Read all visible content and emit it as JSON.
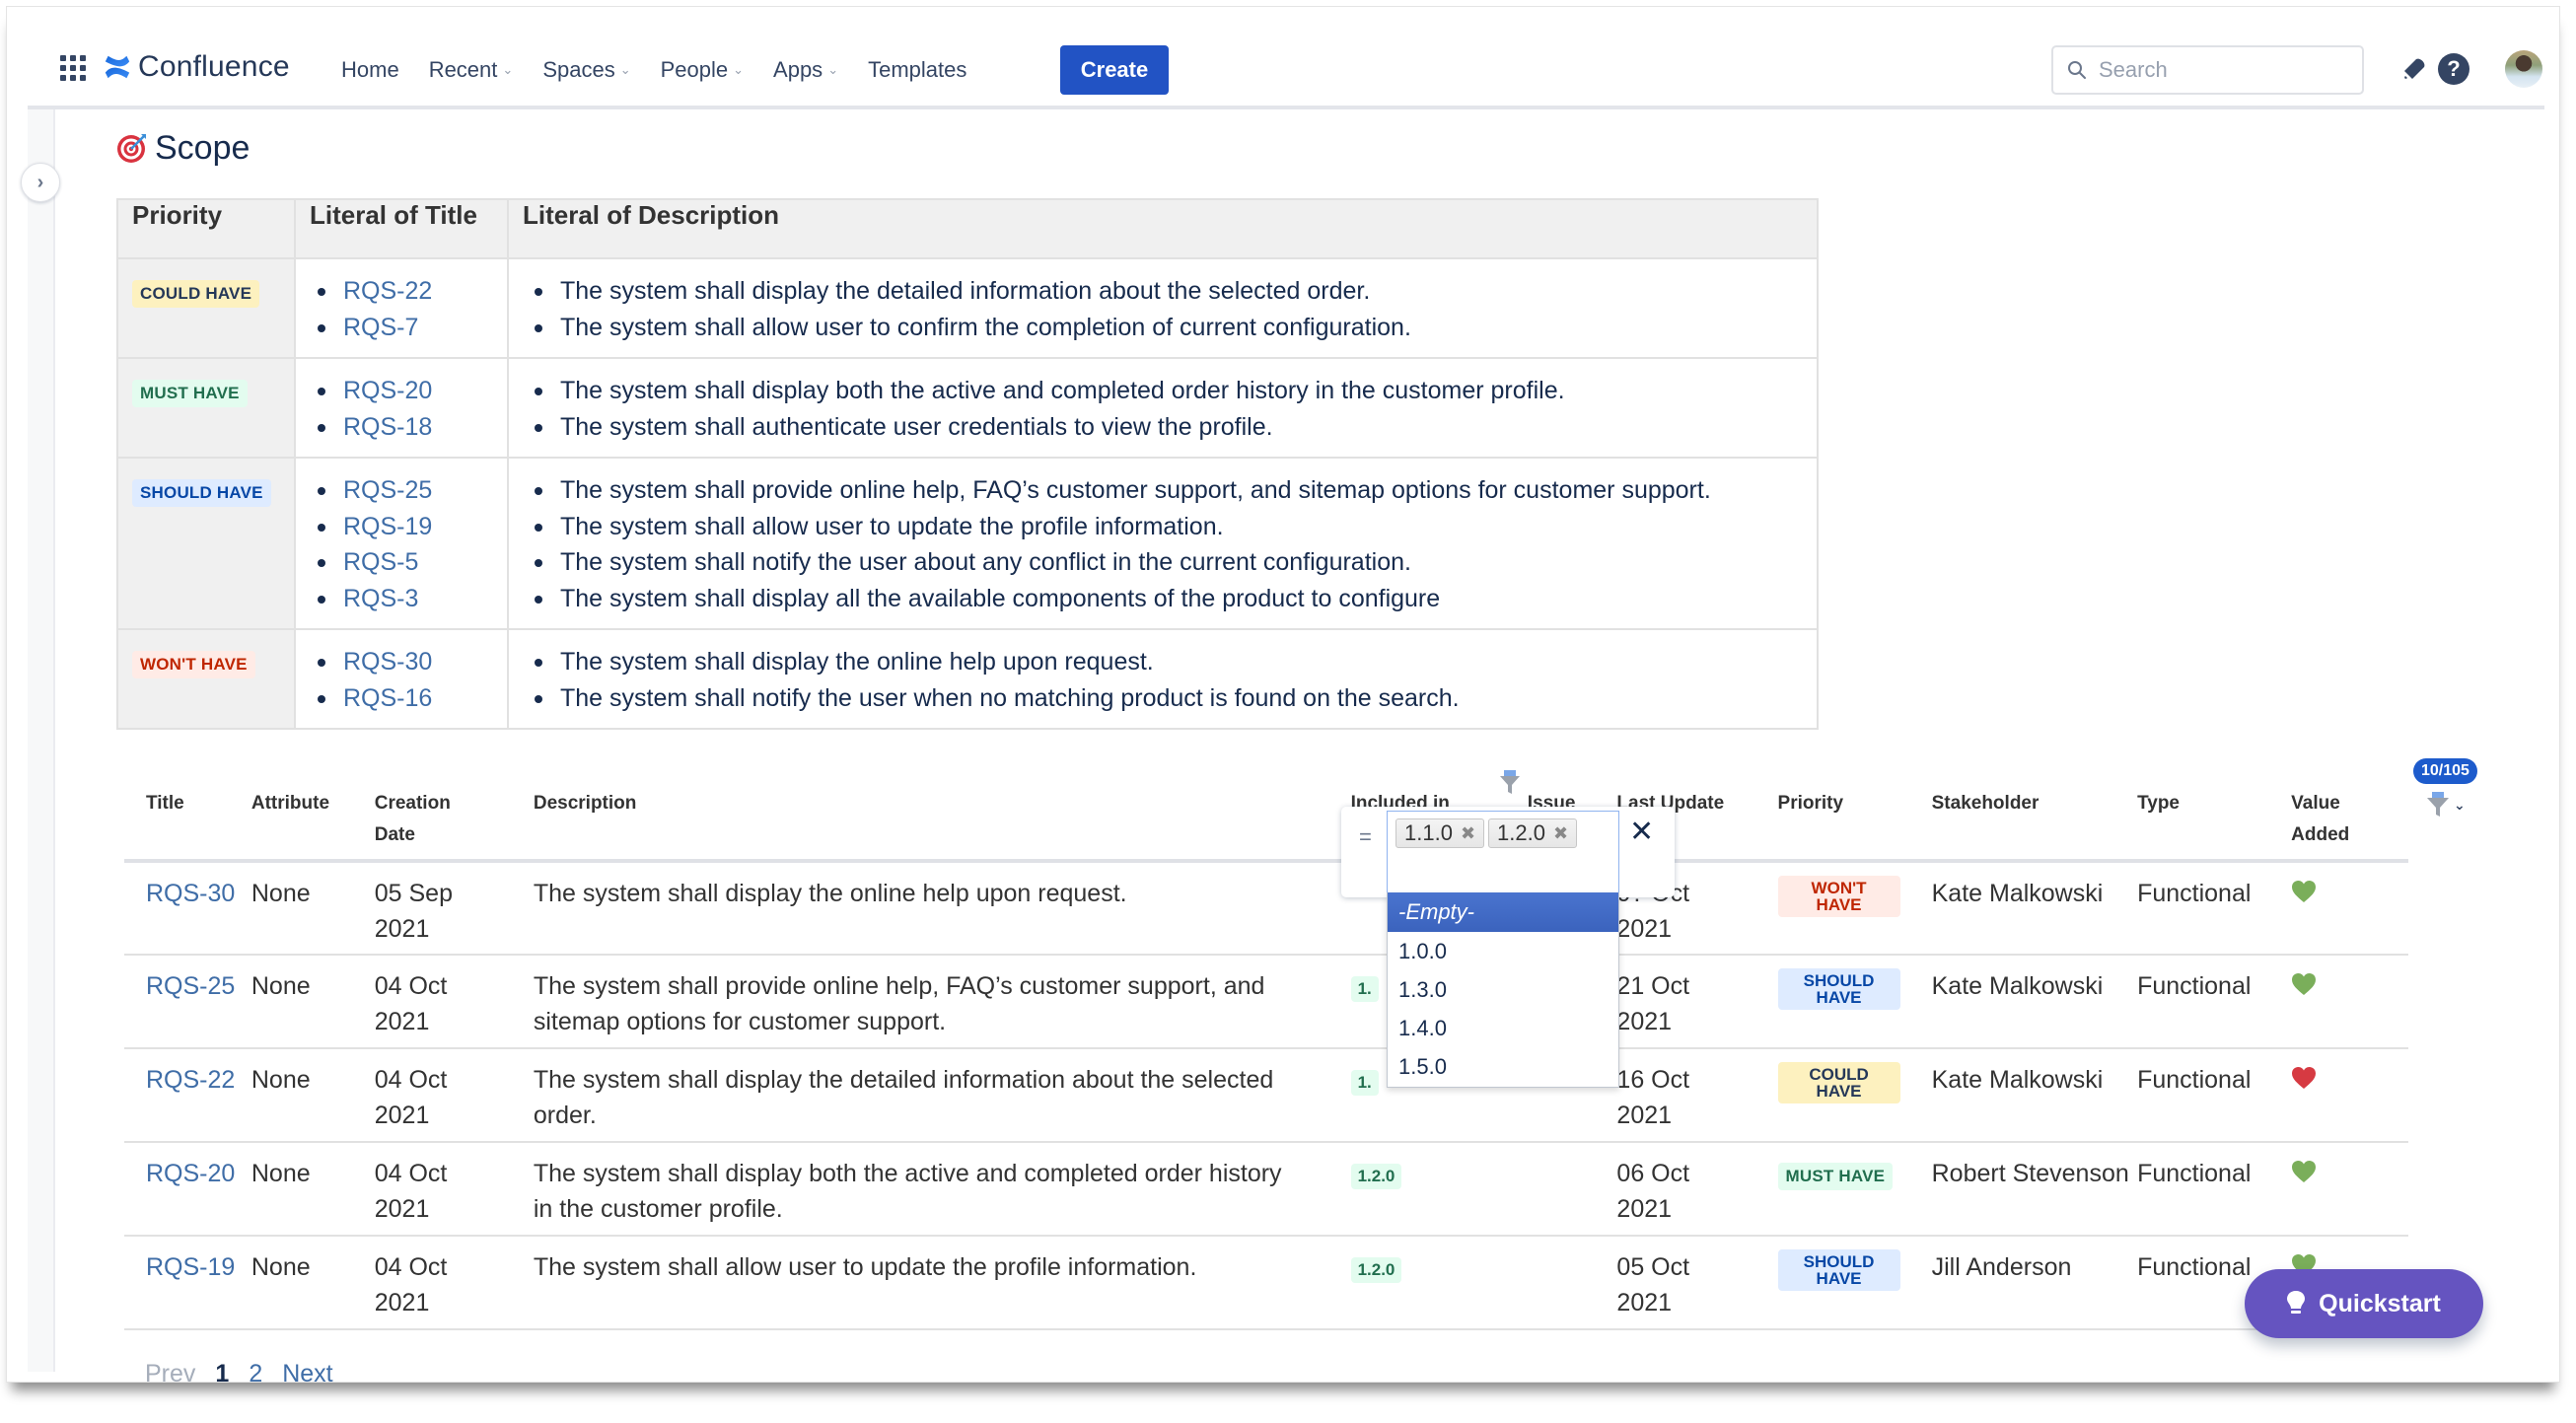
{
  "header": {
    "app_name": "Confluence",
    "nav": [
      {
        "label": "Home",
        "has_dropdown": false
      },
      {
        "label": "Recent",
        "has_dropdown": true
      },
      {
        "label": "Spaces",
        "has_dropdown": true
      },
      {
        "label": "People",
        "has_dropdown": true
      },
      {
        "label": "Apps",
        "has_dropdown": true
      },
      {
        "label": "Templates",
        "has_dropdown": false
      }
    ],
    "create_label": "Create",
    "search_placeholder": "Search",
    "icons": [
      "app-switcher-icon",
      "confluence-logo-icon",
      "notifications-icon",
      "help-icon",
      "avatar"
    ]
  },
  "sidebar": {
    "toggle_icon": "chevron-right-icon"
  },
  "page": {
    "section_title": "Scope",
    "section_icon": "target-icon"
  },
  "scope_table": {
    "headers": [
      "Priority",
      "Literal of Title",
      "Literal of Description"
    ],
    "rows": [
      {
        "priority": "COULD HAVE",
        "priority_style": "could",
        "titles": [
          "RQS-22",
          "RQS-7"
        ],
        "descriptions": [
          "The system shall display the detailed information about the selected order.",
          "The system shall allow user to confirm the completion of current configuration."
        ]
      },
      {
        "priority": "MUST HAVE",
        "priority_style": "must",
        "titles": [
          "RQS-20",
          "RQS-18"
        ],
        "descriptions": [
          "The system shall display both the active and completed order history in the customer profile.",
          "The system shall authenticate user credentials to view the profile."
        ]
      },
      {
        "priority": "SHOULD HAVE",
        "priority_style": "should",
        "titles": [
          "RQS-25",
          "RQS-19",
          "RQS-5",
          "RQS-3"
        ],
        "descriptions": [
          "The system shall provide online help, FAQ’s customer support, and sitemap options for customer support.",
          "The system shall allow user to update the profile information.",
          "The system shall notify the user about any conflict in the current configuration.",
          "The system shall display all the available components of the product to configure"
        ]
      },
      {
        "priority": "WON'T HAVE",
        "priority_style": "wont",
        "titles": [
          "RQS-30",
          "RQS-16"
        ],
        "descriptions": [
          "The system shall display the online help upon request.",
          "The system shall notify the user when no matching product is found on the search."
        ]
      }
    ]
  },
  "req_table": {
    "count_badge": "10/105",
    "headers": {
      "title": "Title",
      "attribute": "Attribute",
      "creation_date": "Creation Date",
      "description": "Description",
      "included_in": "Included in",
      "issue": "Issue",
      "last_update": "Last Update",
      "priority": "Priority",
      "stakeholder": "Stakeholder",
      "type": "Type",
      "value_added": "Value Added"
    },
    "rows": [
      {
        "title": "RQS-30",
        "attribute": "None",
        "created": "05 Sep 2021",
        "description": "The system shall display the online help upon request.",
        "included_in": "",
        "issue": "",
        "last_update": "0? Oct 2021",
        "priority": "WON'T HAVE",
        "priority_style": "wont",
        "stakeholder": "Kate Malkowski",
        "type": "Functional",
        "value_added": "green-heart"
      },
      {
        "title": "RQS-25",
        "attribute": "None",
        "created": "04 Oct 2021",
        "description": "The system shall provide online help, FAQ’s customer support, and sitemap options for customer support.",
        "included_in": "1.",
        "issue": "",
        "last_update": "21 Oct 2021",
        "priority": "SHOULD HAVE",
        "priority_style": "should",
        "stakeholder": "Kate Malkowski",
        "type": "Functional",
        "value_added": "green-heart"
      },
      {
        "title": "RQS-22",
        "attribute": "None",
        "created": "04 Oct 2021",
        "description": "The system shall display the detailed information about the selected order.",
        "included_in": "1.",
        "issue": "",
        "last_update": "16 Oct 2021",
        "priority": "COULD HAVE",
        "priority_style": "could",
        "stakeholder": "Kate Malkowski",
        "type": "Functional",
        "value_added": "red-heart"
      },
      {
        "title": "RQS-20",
        "attribute": "None",
        "created": "04 Oct 2021",
        "description": "The system shall display both the active and completed order history in the customer profile.",
        "included_in": "1.2.0",
        "issue": "",
        "last_update": "06 Oct 2021",
        "priority": "MUST HAVE",
        "priority_style": "must",
        "stakeholder": "Robert Stevenson",
        "type": "Functional",
        "value_added": "green-heart"
      },
      {
        "title": "RQS-19",
        "attribute": "None",
        "created": "04 Oct 2021",
        "description": "The system shall allow user to update the profile information.",
        "included_in": "1.2.0",
        "issue": "",
        "last_update": "05 Oct 2021",
        "priority": "SHOULD HAVE",
        "priority_style": "should",
        "stakeholder": "Jill Anderson",
        "type": "Functional",
        "value_added": "green-heart"
      }
    ]
  },
  "filter_popup": {
    "operator": "=",
    "selected_tags": [
      "1.1.0",
      "1.2.0"
    ],
    "options": [
      "-Empty-",
      "1.0.0",
      "1.3.0",
      "1.4.0",
      "1.5.0"
    ],
    "highlighted_option": "-Empty-"
  },
  "pagination": {
    "prev": "Prev",
    "pages": [
      "1",
      "2"
    ],
    "current": "1",
    "next": "Next"
  },
  "quickstart": {
    "label": "Quickstart"
  },
  "colors": {
    "create_button": "#2253c4",
    "link": "#3f6da7",
    "quickstart": "#6554c0",
    "count_badge": "#1d5bcc",
    "heart_green": "#7aae5a",
    "heart_red": "#d63a42"
  }
}
